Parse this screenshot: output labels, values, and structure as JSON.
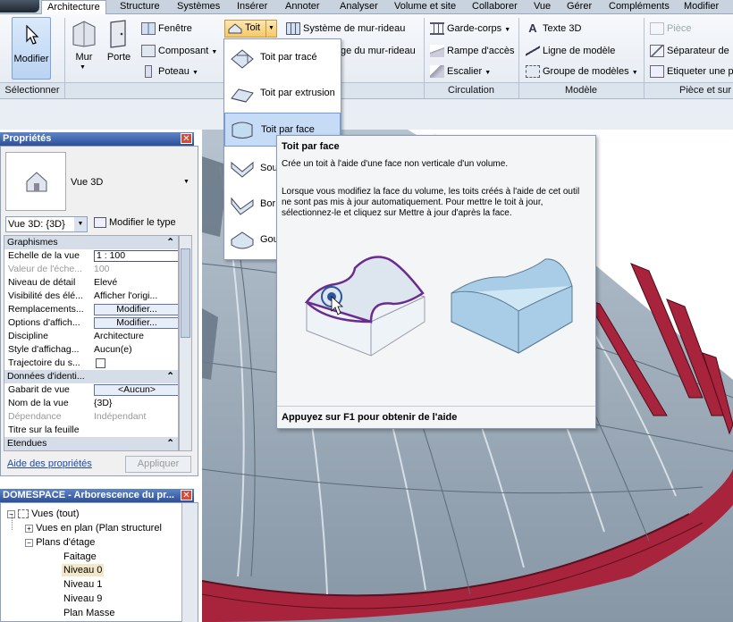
{
  "ribbon": {
    "tabs": [
      "Architecture",
      "Structure",
      "Systèmes",
      "Insérer",
      "Annoter",
      "Analyser",
      "Volume et site",
      "Collaborer",
      "Vue",
      "Gérer",
      "Compléments",
      "Modifier"
    ],
    "active_tab": "Architecture",
    "modify_label": "Modifier",
    "mur_label": "Mur",
    "porte_label": "Porte",
    "fenetre_label": "Fenêtre",
    "composant_label": "Composant",
    "poteau_label": "Poteau",
    "toit_label": "Toit",
    "systeme_mur_rideau_label": "Système de mur-rideau",
    "grille_mur_rideau_label": "ge du mur-rideau",
    "garde_corps_label": "Garde-corps",
    "rampe_label": "Rampe d'accès",
    "escalier_label": "Escalier",
    "texte3d_label": "Texte 3D",
    "ligne_modele_label": "Ligne de modèle",
    "groupe_modeles_label": "Groupe de modèles",
    "piece_label": "Pièce",
    "separateur_label": "Séparateur de",
    "etiqueter_label": "Etiqueter  une p",
    "panels": {
      "selectionner": "Sélectionner",
      "circulation": "Circulation",
      "modele": "Modèle",
      "piece_surface": "Pièce et sur"
    }
  },
  "roof_menu": {
    "items": [
      "Toit par tracé",
      "Toit par extrusion",
      "Toit par face",
      "Sou",
      "Bor",
      "Gou"
    ],
    "selected": "Toit par face"
  },
  "tooltip": {
    "title": "Toit par face",
    "description": "Crée un toit à l'aide d'une face non verticale d'un volume.",
    "body": "Lorsque vous modifiez la face du volume, les toits créés à l'aide de cet outil ne sont pas mis à jour automatiquement. Pour mettre le toit à jour, sélectionnez-le et cliquez sur Mettre à jour d'après la face.",
    "footer": "Appuyez sur F1 pour obtenir de l'aide"
  },
  "properties": {
    "title": "Propriétés",
    "type_name": "Vue 3D",
    "view_selector": "Vue 3D: {3D}",
    "edit_type": "Modifier le type",
    "help_link": "Aide des propriétés",
    "apply_button": "Appliquer",
    "rows": [
      {
        "k": "Graphismes",
        "v": "",
        "group": true
      },
      {
        "k": "Echelle de la vue",
        "v": "1 : 100",
        "input": true
      },
      {
        "k": "Valeur de l'éche...",
        "v": "100",
        "disabled": true
      },
      {
        "k": "Niveau de détail",
        "v": "Elevé"
      },
      {
        "k": "Visibilité des élé...",
        "v": "Afficher l'origi..."
      },
      {
        "k": "Remplacements...",
        "v": "Modifier...",
        "button": true
      },
      {
        "k": "Options d'affich...",
        "v": "Modifier...",
        "button": true
      },
      {
        "k": "Discipline",
        "v": "Architecture"
      },
      {
        "k": "Style d'affichag...",
        "v": "Aucun(e)"
      },
      {
        "k": "Trajectoire du s...",
        "v": "",
        "checkbox": true
      },
      {
        "k": "Données d'identi...",
        "v": "",
        "group": true
      },
      {
        "k": "Gabarit de vue",
        "v": "<Aucun>",
        "button": true
      },
      {
        "k": "Nom de la vue",
        "v": "{3D}"
      },
      {
        "k": "Dépendance",
        "v": "Indépendant",
        "disabled": true
      },
      {
        "k": "Titre sur la feuille",
        "v": ""
      },
      {
        "k": "Etendues",
        "v": "",
        "group": true
      }
    ]
  },
  "browser": {
    "title": "DOMESPACE - Arborescence du pr...",
    "nodes": [
      "Vues (tout)",
      "Vues en plan (Plan structurel",
      "Plans d'étage",
      "Faitage",
      "Niveau 0",
      "Niveau 1",
      "Niveau 9",
      "Plan Masse"
    ]
  }
}
